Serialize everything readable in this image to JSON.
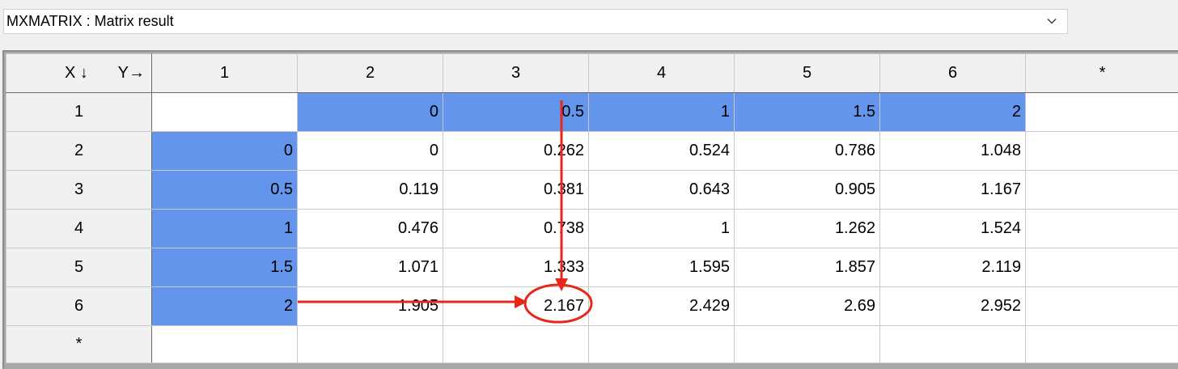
{
  "dropdown": {
    "selected": "MXMATRIX : Matrix result"
  },
  "corner": {
    "x_label": "X ↓",
    "y_label": "Y→"
  },
  "column_headers": [
    "1",
    "2",
    "3",
    "4",
    "5",
    "6",
    "*"
  ],
  "rows": [
    {
      "header": "1",
      "cells": [
        "",
        "0",
        "0.5",
        "1",
        "1.5",
        "2",
        ""
      ]
    },
    {
      "header": "2",
      "cells": [
        "0",
        "0",
        "0.262",
        "0.524",
        "0.786",
        "1.048",
        ""
      ]
    },
    {
      "header": "3",
      "cells": [
        "0.5",
        "0.119",
        "0.381",
        "0.643",
        "0.905",
        "1.167",
        ""
      ]
    },
    {
      "header": "4",
      "cells": [
        "1",
        "0.476",
        "0.738",
        "1",
        "1.262",
        "1.524",
        ""
      ]
    },
    {
      "header": "5",
      "cells": [
        "1.5",
        "1.071",
        "1.333",
        "1.595",
        "1.857",
        "2.119",
        ""
      ]
    },
    {
      "header": "6",
      "cells": [
        "2",
        "1.905",
        "2.167",
        "2.429",
        "2.69",
        "2.952",
        ""
      ]
    },
    {
      "header": "*",
      "cells": [
        "",
        "",
        "",
        "",
        "",
        "",
        ""
      ]
    }
  ],
  "colors": {
    "selection": "#6495ed",
    "annotation": "#e8261a",
    "header_bg": "#f0f0f0"
  },
  "icons": {
    "dropdown_arrow": "chevron-down-icon"
  }
}
